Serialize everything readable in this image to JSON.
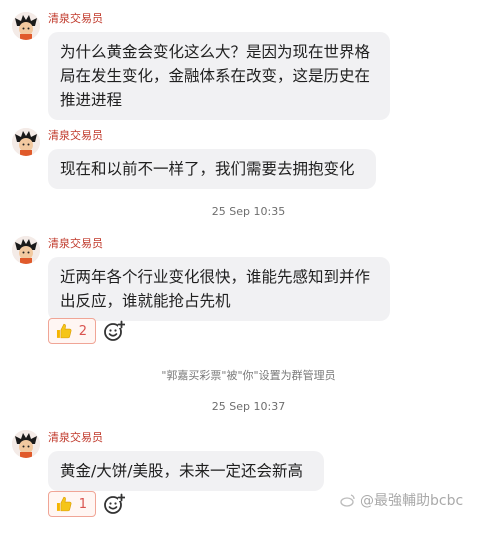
{
  "messages": [
    {
      "sender": "清泉交易员",
      "text": "为什么黄金会变化这么大？是因为现在世界格局在发生变化，金融体系在改变，这是历史在推进进程"
    },
    {
      "sender": "清泉交易员",
      "text": "现在和以前不一样了，我们需要去拥抱变化"
    },
    {
      "sender": "清泉交易员",
      "text": "近两年各个行业变化很快，谁能先感知到并作出反应，谁就能抢占先机",
      "reaction": {
        "icon": "thumbs-up-icon",
        "count": "2"
      }
    },
    {
      "sender": "清泉交易员",
      "text": "黄金/大饼/美股，未来一定还会新高",
      "reaction": {
        "icon": "thumbs-up-icon",
        "count": "1"
      }
    }
  ],
  "timestamps": [
    "25 Sep 10:35",
    "25 Sep 10:37"
  ],
  "system_notice": "\"郭嘉买彩票\"被\"你\"设置为群管理员",
  "watermark": "@最強輔助bcbc",
  "colors": {
    "sender": "#c0392b",
    "bubble": "#f1f1f3",
    "reaction_border": "#f0a596",
    "reaction_count": "#d9534f"
  }
}
